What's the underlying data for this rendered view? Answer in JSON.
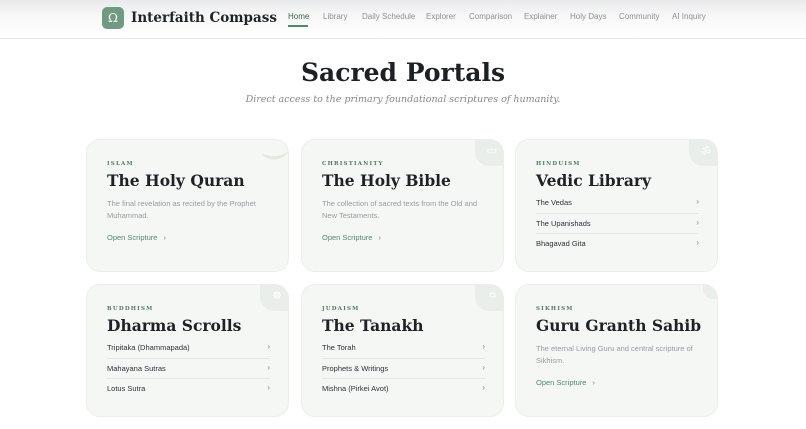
{
  "header": {
    "logo_glyph": "Ω",
    "brand": "Interfaith Compass",
    "nav": [
      "Home",
      "Library",
      "Daily Schedule",
      "Explorer",
      "Comparison",
      "Explainer",
      "Holy Days",
      "Community",
      "AI Inquiry"
    ],
    "active_nav": "Home"
  },
  "hero": {
    "title": "Sacred Portals",
    "subtitle": "Direct access to the primary foundational scriptures of humanity."
  },
  "cards": [
    {
      "tag": "ISLAM",
      "title": "The Holy Quran",
      "description": "The final revelation as recited by the Prophet Muhammad.",
      "link": "Open Scripture",
      "icon": "crescent-icon"
    },
    {
      "tag": "CHRISTIANITY",
      "title": "The Holy Bible",
      "description": "The collection of sacred texts from the Old and New Testaments.",
      "link": "Open Scripture",
      "icon": "book-icon"
    },
    {
      "tag": "HINDUISM",
      "title": "Vedic Library",
      "items": [
        "The Vedas",
        "The Upanishads",
        "Bhagavad Gita"
      ],
      "icon": "om-icon"
    },
    {
      "tag": "BUDDHISM",
      "title": "Dharma Scrolls",
      "items": [
        "Tripitaka (Dhammapada)",
        "Mahayana Sutras",
        "Lotus Sutra"
      ],
      "icon": "dharma-wheel-icon"
    },
    {
      "tag": "JUDAISM",
      "title": "The Tanakh",
      "items": [
        "The Torah",
        "Prophets & Writings",
        "Mishna (Pirkei Avot)"
      ],
      "icon": "star-icon"
    },
    {
      "tag": "SIKHISM",
      "title": "Guru Granth Sahib",
      "description": "The eternal Living Guru and central scripture of Sikhism.",
      "link": "Open Scripture",
      "icon": "khanda-icon"
    }
  ],
  "chevron": "›"
}
